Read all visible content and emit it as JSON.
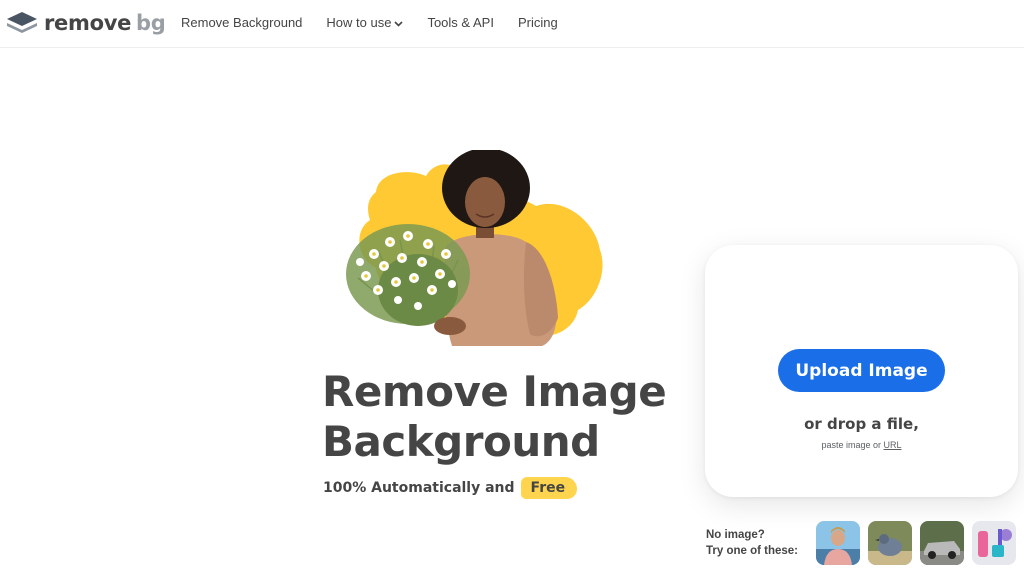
{
  "header": {
    "logo": {
      "word1": "remove",
      "word2": "bg",
      "icon": "layers-logo-icon"
    },
    "nav": [
      {
        "label": "Remove Background"
      },
      {
        "label": "How to use",
        "has_dropdown": true
      },
      {
        "label": "Tools & API"
      },
      {
        "label": "Pricing"
      }
    ]
  },
  "hero": {
    "title_line1": "Remove Image",
    "title_line2": "Background",
    "subtitle": "100% Automatically and",
    "badge": "Free",
    "accent_color": "#ffc933"
  },
  "upload": {
    "button_label": "Upload Image",
    "drop_text": "or drop a file,",
    "paste_prefix": "paste image or ",
    "paste_link": "URL",
    "button_color": "#1a6ee8"
  },
  "samples": {
    "line1": "No image?",
    "line2": "Try one of these:",
    "items": [
      "person-sample",
      "bird-sample",
      "car-sample",
      "product-sample"
    ]
  }
}
